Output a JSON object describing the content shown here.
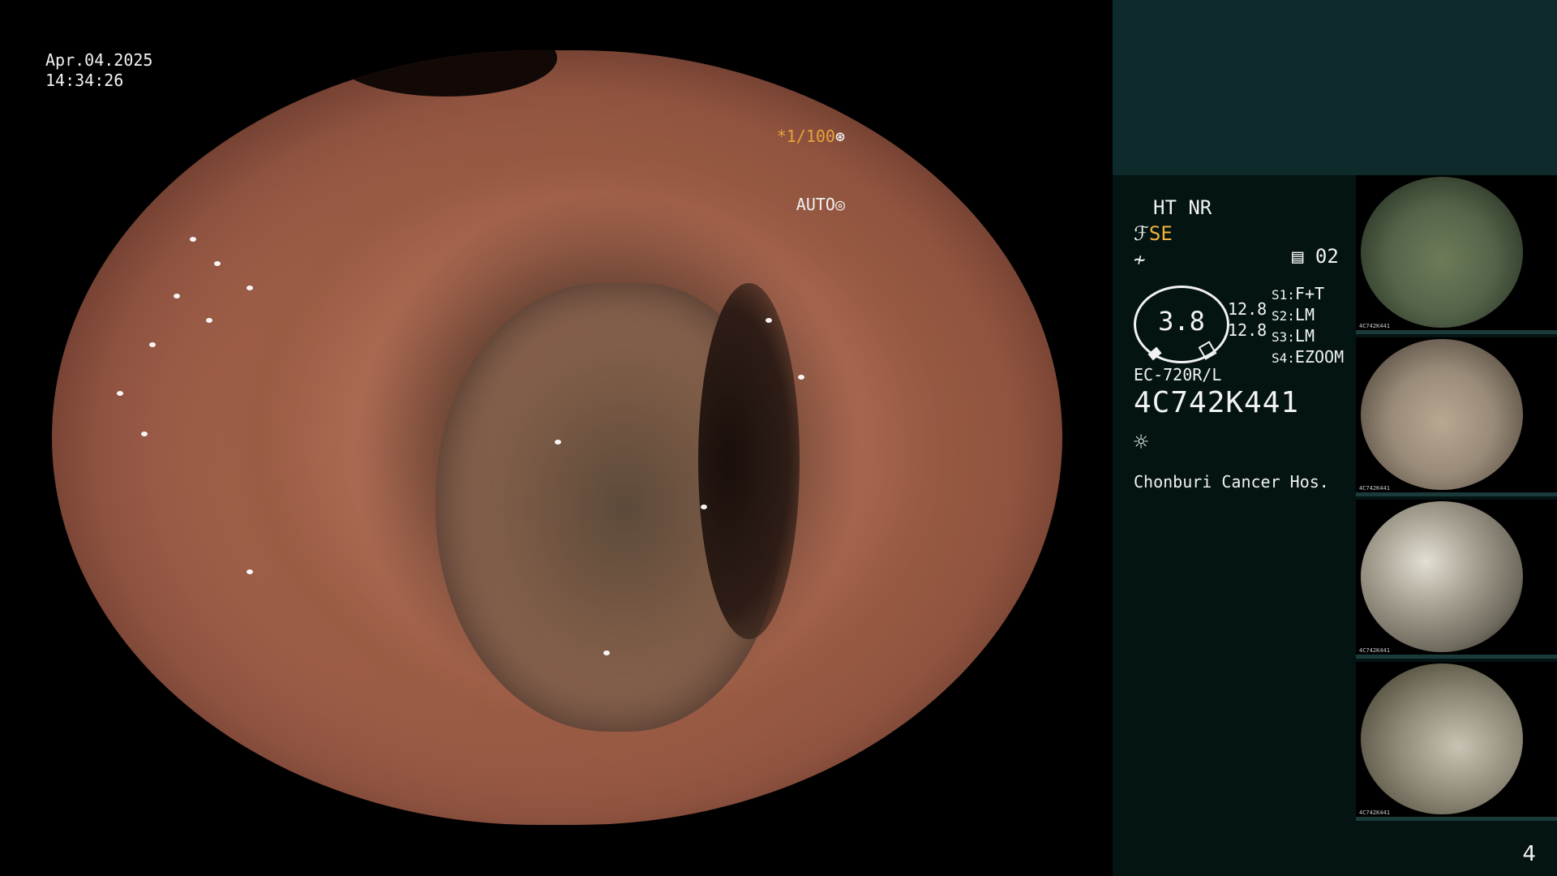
{
  "overlay": {
    "date": "Apr.04.2025",
    "time": "14:34:26",
    "shutter": "*1/100",
    "iris": "AUTO"
  },
  "panel": {
    "enhance": "HT NR",
    "structure": "SE",
    "memory": "02",
    "gauge_value": "3.8",
    "gauge_nums": [
      "12.8",
      "12.8"
    ],
    "scenes": [
      {
        "key": "S1:",
        "value": "F+T"
      },
      {
        "key": "S2:",
        "value": "LM"
      },
      {
        "key": "S3:",
        "value": "LM"
      },
      {
        "key": "S4:",
        "value": "EZOOM"
      }
    ],
    "scope_model": "EC-720R/L",
    "serial": "4C742K441",
    "hospital": "Chonburi Cancer Hos."
  },
  "thumbnails": [
    {
      "serial": "4C742K441"
    },
    {
      "serial": "4C742K441"
    },
    {
      "serial": "4C742K441"
    },
    {
      "serial": "4C742K441"
    }
  ],
  "page_number": "4",
  "colors": {
    "panel_bg": "#031413",
    "panel_header": "#0e2a2a",
    "accent_orange": "#f0b23a"
  },
  "icons": [
    "aperture-icon",
    "auto-iris-icon",
    "structure-icon",
    "color-icon",
    "memory-icon",
    "light-source-icon"
  ]
}
